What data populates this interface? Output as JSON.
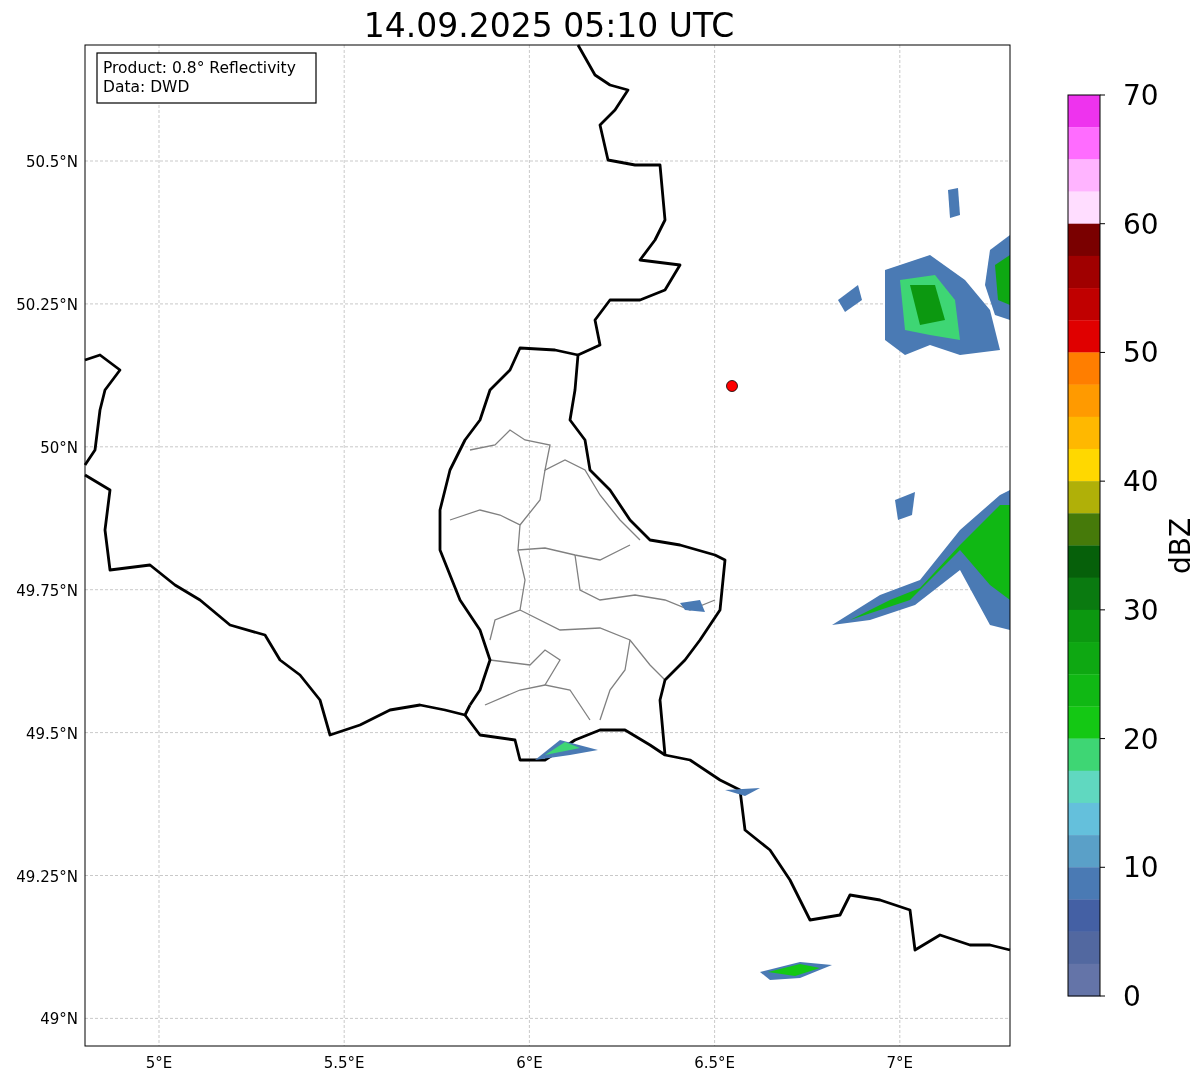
{
  "title": "14.09.2025 05:10 UTC",
  "info_box": [
    "Product: 0.8° Reflectivity",
    "Data: DWD"
  ],
  "map": {
    "lon_ticks": [
      "5°E",
      "5.5°E",
      "6°E",
      "6.5°E",
      "7°E"
    ],
    "lat_ticks": [
      "50.5°N",
      "50.25°N",
      "50°N",
      "49.75°N",
      "49.5°N",
      "49.25°N",
      "49°N"
    ]
  },
  "colorbar": {
    "label": "dBZ",
    "ticks": [
      "70",
      "60",
      "50",
      "40",
      "30",
      "20",
      "10",
      "0"
    ],
    "segments": [
      {
        "color": "#ee33ee"
      },
      {
        "color": "#ff6cff"
      },
      {
        "color": "#ffb4ff"
      },
      {
        "color": "#ffddff"
      },
      {
        "color": "#7a0000"
      },
      {
        "color": "#a00000"
      },
      {
        "color": "#c00000"
      },
      {
        "color": "#e00000"
      },
      {
        "color": "#ff7e00"
      },
      {
        "color": "#ff9a00"
      },
      {
        "color": "#ffb800"
      },
      {
        "color": "#ffd800"
      },
      {
        "color": "#b0b008"
      },
      {
        "color": "#467a0a"
      },
      {
        "color": "#06600a"
      },
      {
        "color": "#0a7a10"
      },
      {
        "color": "#0c9810"
      },
      {
        "color": "#0ea812"
      },
      {
        "color": "#10b814"
      },
      {
        "color": "#14c814"
      },
      {
        "color": "#3ed674"
      },
      {
        "color": "#60d8c0"
      },
      {
        "color": "#64c0dc"
      },
      {
        "color": "#5aa0c8"
      },
      {
        "color": "#4a7ab4"
      },
      {
        "color": "#4460a4"
      },
      {
        "color": "#5268a0"
      },
      {
        "color": "#6474a8"
      }
    ]
  }
}
